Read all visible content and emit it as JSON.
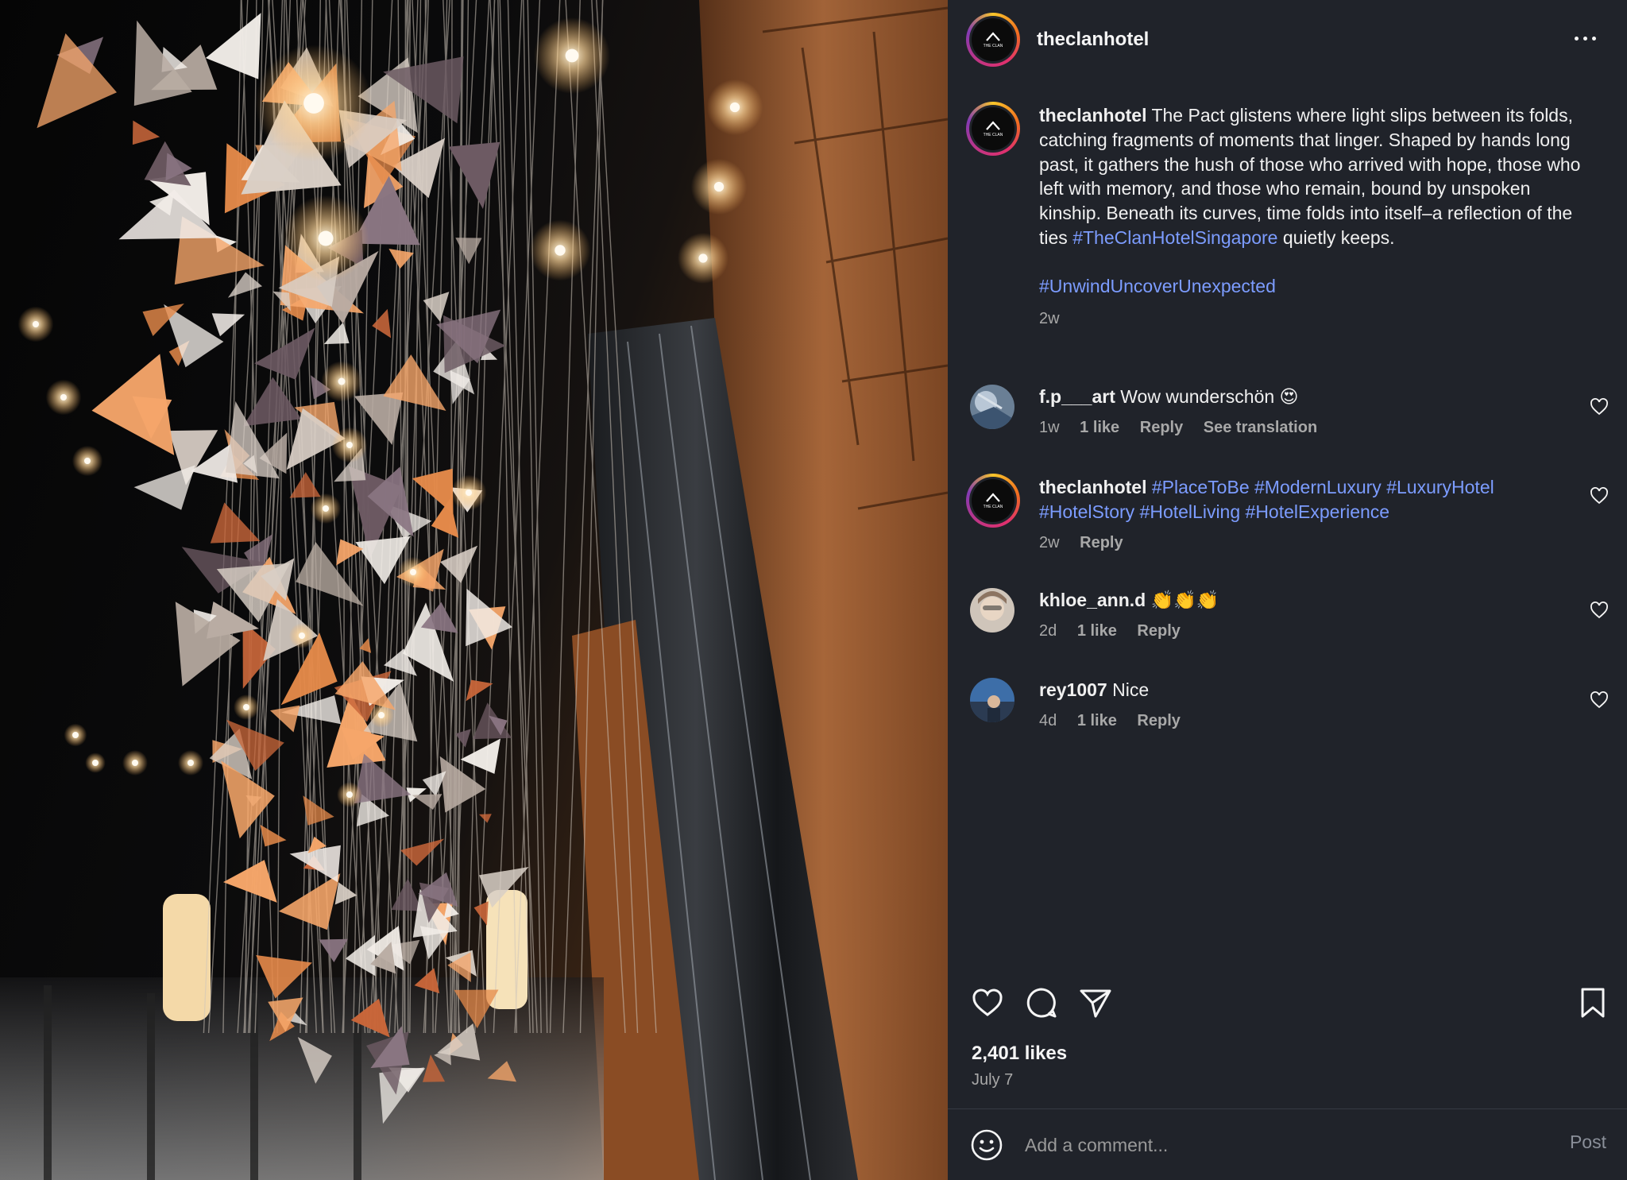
{
  "header": {
    "username": "theclanhotel",
    "more_icon": "more-horizontal-icon"
  },
  "avatar_logo_text": "THE CLAN",
  "caption": {
    "username": "theclanhotel",
    "text": "The Pact glistens where light slips between its folds, catching fragments of moments that linger. Shaped by hands long past, it gathers the hush of those who arrived with hope, those who left with memory, and those who remain, bound by unspoken kinship. Beneath its curves, time folds into itself–a reflection of the ties",
    "hashtag_inline": "#TheClanHotelSingapore",
    "text_end": "quietly keeps.",
    "hashtag_block": "#UnwindUncoverUnexpected",
    "age": "2w"
  },
  "comments": [
    {
      "username": "f.p___art",
      "text": "Wow wunderschön 😍",
      "age": "1w",
      "likes": "1 like",
      "reply": "Reply",
      "translate": "See translation"
    },
    {
      "username": "theclanhotel",
      "tags": "#PlaceToBe #ModernLuxury #LuxuryHotel #HotelStory #HotelLiving #HotelExperience",
      "age": "2w",
      "reply": "Reply"
    },
    {
      "username": "khloe_ann.d",
      "text": "👏👏👏",
      "age": "2d",
      "likes": "1 like",
      "reply": "Reply"
    },
    {
      "username": "rey1007",
      "text": "Nice",
      "age": "4d",
      "likes": "1 like",
      "reply": "Reply"
    }
  ],
  "actions": {
    "like_icon": "heart-icon",
    "comment_icon": "comment-icon",
    "share_icon": "send-icon",
    "save_icon": "bookmark-icon"
  },
  "likes_count": "2,401 likes",
  "post_date": "July 7",
  "add_comment": {
    "placeholder": "Add a comment...",
    "post_label": "Post",
    "emoji_icon": "smiley-icon"
  },
  "colors": {
    "panel_bg": "#20232a",
    "hashtag": "#7c9cff",
    "muted": "#a8a8a8"
  }
}
